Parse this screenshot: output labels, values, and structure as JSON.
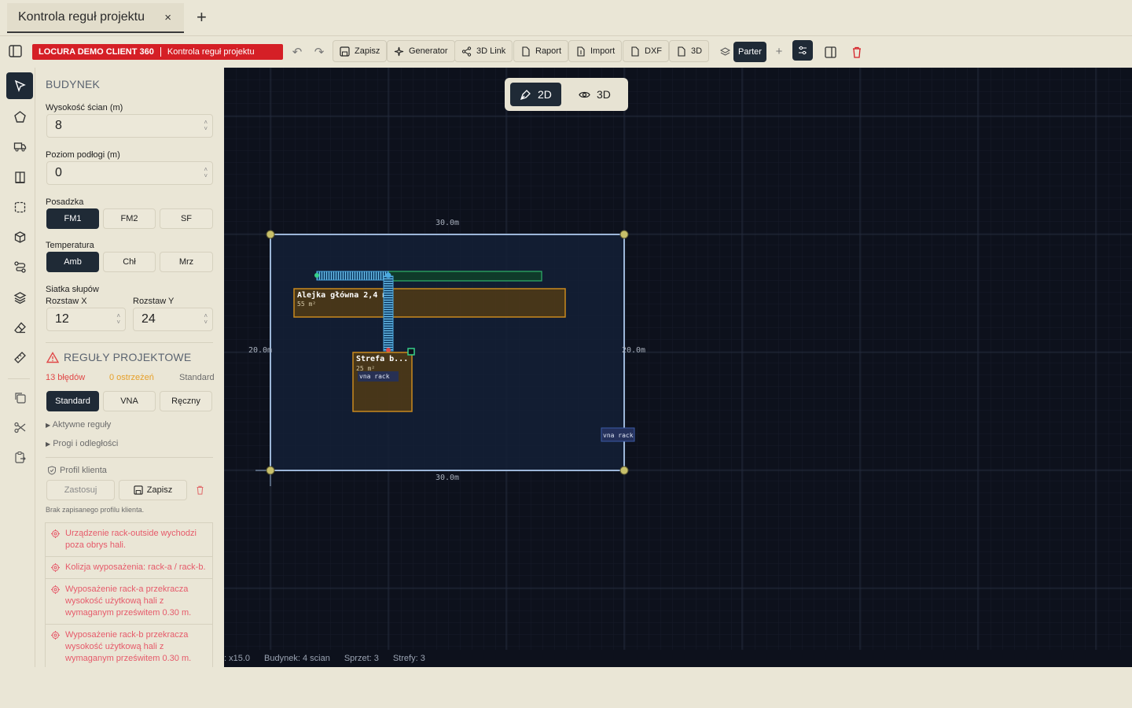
{
  "tab": {
    "title": "Kontrola reguł projektu",
    "close": "×",
    "new": "+"
  },
  "toolbar": {
    "client": "LOCURA DEMO CLIENT 360",
    "project": "Kontrola reguł projektu",
    "buttons": [
      {
        "label": "Zapisz",
        "icon": "save-icon"
      },
      {
        "label": "Generator",
        "icon": "sparkle-icon"
      },
      {
        "label": "3D Link",
        "icon": "share-icon"
      },
      {
        "label": "Raport",
        "icon": "file-icon"
      },
      {
        "label": "Import",
        "icon": "file-import-icon"
      },
      {
        "label": "DXF",
        "icon": "file-icon"
      },
      {
        "label": "3D",
        "icon": "file-icon"
      }
    ],
    "floor": "Parter",
    "add": "+"
  },
  "panel": {
    "building_title": "BUDYNEK",
    "wall_height_label": "Wysokość ścian (m)",
    "wall_height": "8",
    "floor_level_label": "Poziom podłogi (m)",
    "floor_level": "0",
    "flooring_label": "Posadzka",
    "flooring_options": [
      "FM1",
      "FM2",
      "SF"
    ],
    "temperature_label": "Temperatura",
    "temperature_options": [
      "Amb",
      "Chł",
      "Mrz"
    ],
    "grid_label": "Siatka słupów",
    "spacing_x_label": "Rozstaw X",
    "spacing_x": "12",
    "spacing_y_label": "Rozstaw Y",
    "spacing_y": "24",
    "rules_title": "REGUŁY PROJEKTOWE",
    "errors": "13 błędów",
    "warnings": "0 ostrzeżeń",
    "mode": "Standard",
    "rule_modes": [
      "Standard",
      "VNA",
      "Ręczny"
    ],
    "active_rules": "Aktywne reguły",
    "thresholds": "Progi i odległości",
    "client_profile": "Profil klienta",
    "apply": "Zastosuj",
    "save": "Zapisz",
    "no_profile": "Brak zapisanego profilu klienta.",
    "issues": [
      "Urządzenie rack-outside wychodzi poza obrys hali.",
      "Kolizja wyposażenia: rack-a / rack-b.",
      "Wyposażenie rack-a przekracza wysokość użytkową hali z wymaganym prześwitem 0.30 m.",
      "Wyposażenie rack-b przekracza wysokość użytkową hali z wymaganym prześwitem 0.30 m."
    ]
  },
  "canvas": {
    "view_2d": "2D",
    "view_3d": "3D",
    "dim_top": "30.0m",
    "dim_bottom": "30.0m",
    "dim_left": "20.0m",
    "dim_right": "20.0m",
    "aisle_label": "Alejka główna 2,4 m",
    "aisle_area": "55 m²",
    "zone_label": "Strefa b...",
    "zone_area": "25 m²",
    "vna_label_1": "vna rack",
    "vna_label_2": "vna rack"
  },
  "status": {
    "zoom": "x15.0",
    "building": "Budynek: 4 scian",
    "equipment": "Sprzet: 3",
    "zones": "Strefy: 3"
  },
  "colors": {
    "accent_dark": "#1f2a36",
    "error_red": "#d51f26",
    "warning": "#e6a02a",
    "canvas_bg": "#0d111c",
    "zone_orange": "#c98a1e",
    "rack_blue": "#4aa8e0",
    "aisle_green": "#2fb36a"
  }
}
